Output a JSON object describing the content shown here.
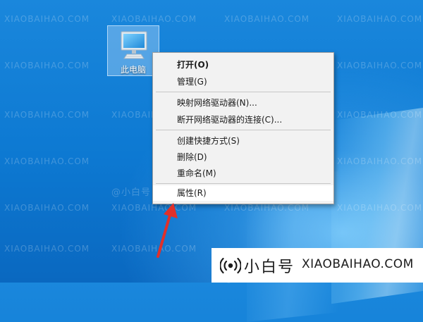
{
  "desktop": {
    "icon_label": "此电脑",
    "icon_name": "computer-icon"
  },
  "context_menu": {
    "items": [
      {
        "label": "打开(O)",
        "bold": true
      },
      {
        "label": "管理(G)"
      },
      {
        "label": "映射网络驱动器(N)..."
      },
      {
        "label": "断开网络驱动器的连接(C)..."
      },
      {
        "label": "创建快捷方式(S)"
      },
      {
        "label": "删除(D)"
      },
      {
        "label": "重命名(M)"
      },
      {
        "label": "属性(R)",
        "highlighted": true
      }
    ]
  },
  "watermark": {
    "text": "XIAOBAIHAO.COM",
    "cn_small": "@小白号"
  },
  "banner": {
    "cn": "小白号",
    "en": "XIAOBAIHAO.COM",
    "icon_name": "radio-signal-icon"
  },
  "colors": {
    "desktop_blue": "#0d79d2",
    "menu_bg": "#f2f2f2",
    "arrow_red": "#e0302a"
  }
}
